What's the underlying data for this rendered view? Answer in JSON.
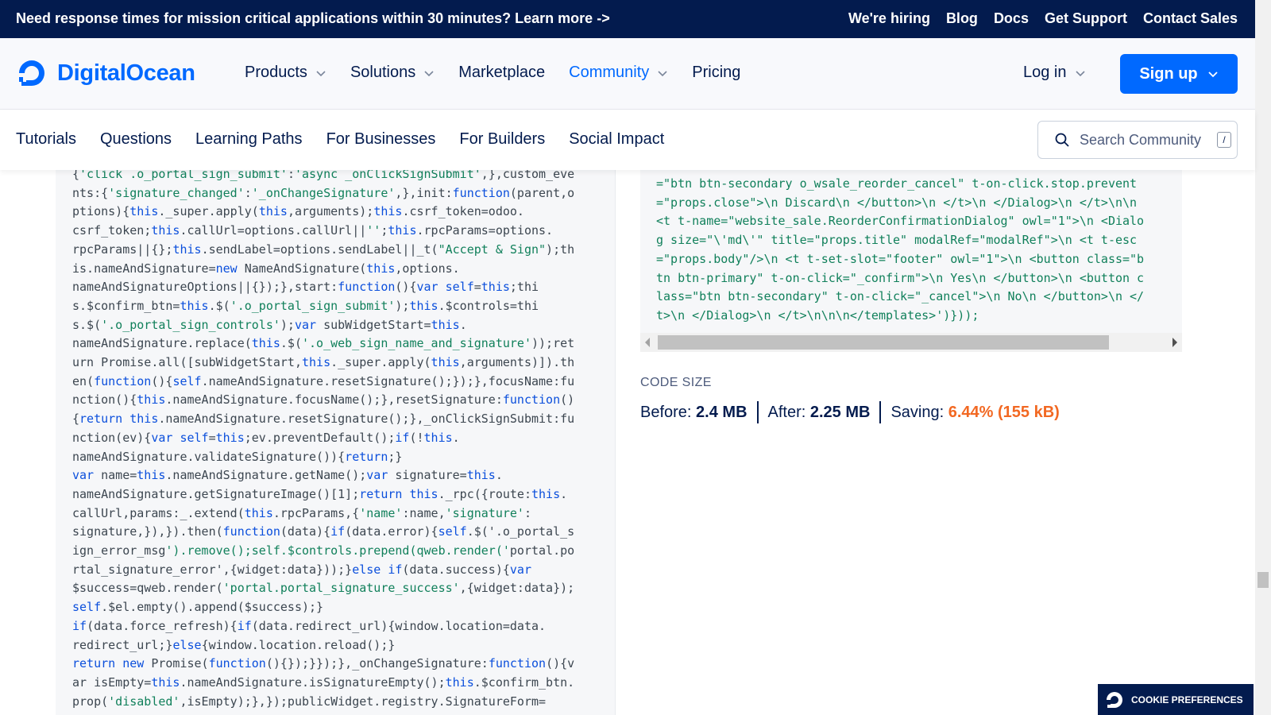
{
  "banner": {
    "message": "Need response times for mission critical applications within 30 minutes? Learn more ->",
    "links": [
      "We're hiring",
      "Blog",
      "Docs",
      "Get Support",
      "Contact Sales"
    ]
  },
  "nav": {
    "logo_text": "DigitalOcean",
    "items": [
      {
        "label": "Products",
        "dropdown": true
      },
      {
        "label": "Solutions",
        "dropdown": true
      },
      {
        "label": "Marketplace",
        "dropdown": false
      },
      {
        "label": "Community",
        "dropdown": true,
        "active": true
      },
      {
        "label": "Pricing",
        "dropdown": false
      }
    ],
    "login": "Log in",
    "signup": "Sign up"
  },
  "subnav": {
    "items": [
      "Tutorials",
      "Questions",
      "Learning Paths",
      "For Businesses",
      "For Builders",
      "Social Impact"
    ],
    "search_placeholder": "Search Community",
    "search_shortcut": "/"
  },
  "code_left": [
    "{'click .o_portal_sign_submit':'async _onClickSignSubmit',},custom_eve",
    "nts:{'signature_changed':'_onChangeSignature',},init:function(parent,o",
    "ptions){this._super.apply(this,arguments);this.csrf_token=odoo.",
    "csrf_token;this.callUrl=options.callUrl||'';this.rpcParams=options.",
    "rpcParams||{};this.sendLabel=options.sendLabel||_t(\"Accept & Sign\");th",
    "is.nameAndSignature=new NameAndSignature(this,options.",
    "nameAndSignatureOptions||{});},start:function(){var self=this;thi",
    "s.$confirm_btn=this.$('.o_portal_sign_submit');this.$controls=thi",
    "s.$('.o_portal_sign_controls');var subWidgetStart=this.",
    "nameAndSignature.replace(this.$('.o_web_sign_name_and_signature'));ret",
    "urn Promise.all([subWidgetStart,this._super.apply(this,arguments)]).th",
    "en(function(){self.nameAndSignature.resetSignature();});},focusName:fu",
    "nction(){this.nameAndSignature.focusName();},resetSignature:function()",
    "{return this.nameAndSignature.resetSignature();},_onClickSignSubmit:fu",
    "nction(ev){var self=this;ev.preventDefault();if(!this.",
    "nameAndSignature.validateSignature()){return;}",
    "var name=this.nameAndSignature.getName();var signature=this.",
    "nameAndSignature.getSignatureImage()[1];return this._rpc({route:this.",
    "callUrl,params:_.extend(this.rpcParams,{'name':name,'signature':",
    "signature,}),}).then(function(data){if(data.error){self.$('.o_portal_s",
    "ign_error_msg').remove();self.$controls.prepend(qweb.render('portal.po",
    "rtal_signature_error',{widget:data}));}else if(data.success){var",
    "$success=qweb.render('portal.portal_signature_success',{widget:data});",
    "self.$el.empty().append($success);}",
    "if(data.force_refresh){if(data.redirect_url){window.location=data.",
    "redirect_url;}else{window.location.reload();}",
    "return new Promise(function(){});}});},_onChangeSignature:function(){v",
    "ar isEmpty=this.nameAndSignature.isSignatureEmpty();this.$confirm_btn.",
    "prop('disabled',isEmpty);},});publicWidget.registry.SignatureForm="
  ],
  "code_right": [
    "=\"btn btn-secondary o_wsale_reorder_cancel\" t-on-click.stop.prevent",
    "=\"props.close\">\\n Discard\\n </button>\\n </t>\\n </Dialog>\\n </t>\\n\\n",
    "<t t-name=\"website_sale.ReorderConfirmationDialog\" owl=\"1\">\\n <Dialo",
    "g size=\"\\'md\\'\" title=\"props.title\" modalRef=\"modalRef\">\\n <t t-esc",
    "=\"props.body\"/>\\n <t t-set-slot=\"footer\" owl=\"1\">\\n <button class=\"b",
    "tn btn-primary\" t-on-click=\"_confirm\">\\n Yes\\n </button>\\n <button c",
    "lass=\"btn btn-secondary\" t-on-click=\"_cancel\">\\n No\\n </button>\\n </",
    "t>\\n </Dialog>\\n </t>\\n\\n\\n</templates>')}));"
  ],
  "code_size": {
    "title": "CODE SIZE",
    "before_label": "Before:",
    "before_value": "2.4 MB",
    "after_label": "After:",
    "after_value": "2.25 MB",
    "saving_label": "Saving:",
    "saving_value": "6.44% (155 kB)"
  },
  "cookie": "COOKIE PREFERENCES",
  "colors": {
    "brand": "#0069ff",
    "navy": "#031b4e",
    "saving": "#f26822",
    "code_string": "#11805b",
    "code_keyword": "#0b4fdc"
  }
}
